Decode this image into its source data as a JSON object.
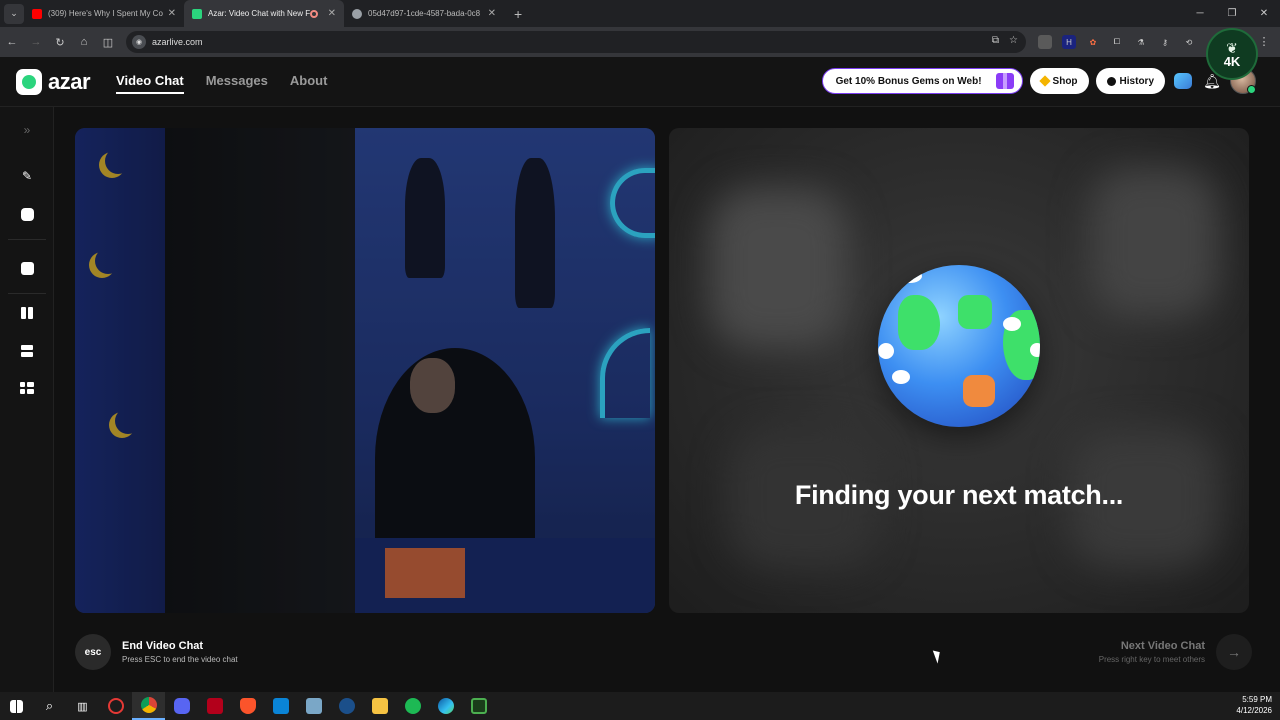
{
  "browser": {
    "tabs": [
      {
        "title": "(309) Here's Why I Spent My Co",
        "favicon_color": "#ff0000",
        "active": false
      },
      {
        "title": "Azar: Video Chat with New F",
        "favicon_color": "#2bd47d",
        "active": true
      },
      {
        "title": "05d47d97-1cde-4587-bada-0c8",
        "favicon_color": "#9aa0a6",
        "active": false
      }
    ],
    "url": "azarlive.com"
  },
  "watermark": {
    "text": "4K",
    "label": "STREAMER"
  },
  "header": {
    "logo_text": "azar",
    "nav": [
      {
        "label": "Video Chat",
        "active": true
      },
      {
        "label": "Messages",
        "active": false
      },
      {
        "label": "About",
        "active": false
      }
    ],
    "promo_label": "Get 10% Bonus Gems on Web!",
    "shop_label": "Shop",
    "history_label": "History"
  },
  "main": {
    "status_text": "Finding your next match...",
    "end_chat": {
      "key": "esc",
      "title": "End Video Chat",
      "subtitle": "Press ESC to end the video chat"
    },
    "next_chat": {
      "title": "Next Video Chat",
      "subtitle": "Press right key to meet others",
      "icon": "arrow-right-icon"
    }
  },
  "taskbar": {
    "time": "5:59 PM",
    "date": "4/12/2026"
  },
  "colors": {
    "brand": "#2bd47d",
    "background": "#111111",
    "promo_border": "#7a3cf0",
    "gem": "#f4b400"
  }
}
